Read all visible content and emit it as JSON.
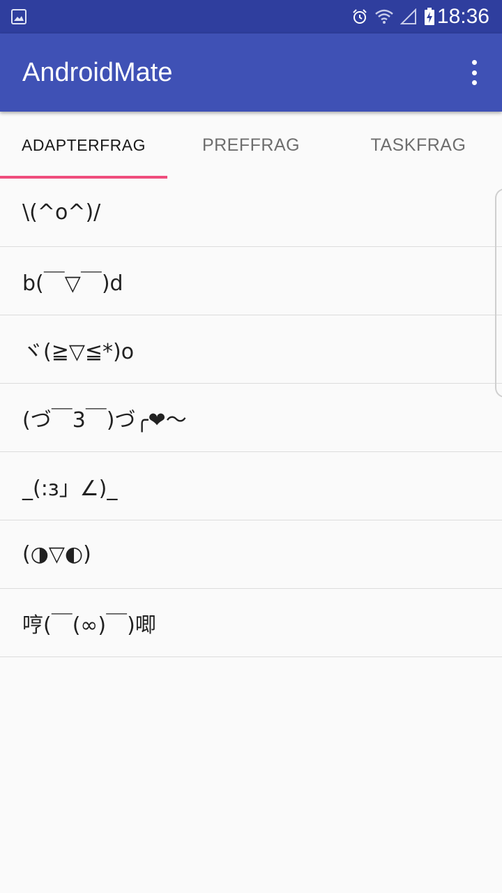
{
  "status_bar": {
    "time": "18:36",
    "icons": [
      "image-icon",
      "alarm-icon",
      "wifi-icon",
      "signal-icon",
      "battery-charging-icon"
    ]
  },
  "app_bar": {
    "title": "AndroidMate",
    "menu_icon": "more-vert-icon"
  },
  "tabs": [
    {
      "label": "ADAPTERFRAG",
      "active": true
    },
    {
      "label": "PREFFRAG",
      "active": false
    },
    {
      "label": "TASKFRAG",
      "active": false
    }
  ],
  "colors": {
    "status_bar": "#2f3e9e",
    "app_bar": "#3f51b5",
    "tab_indicator": "#ef4d7d",
    "background": "#fafafa"
  },
  "list": {
    "items": [
      "\\(^o^)/",
      "b(￣▽￣)d",
      "ヾ(≧▽≦*)o",
      "(づ￣3￣)づ╭❤～",
      "_(:з」∠)_",
      "(◑▽◐)",
      "哼(￣(∞)￣)唧"
    ]
  }
}
